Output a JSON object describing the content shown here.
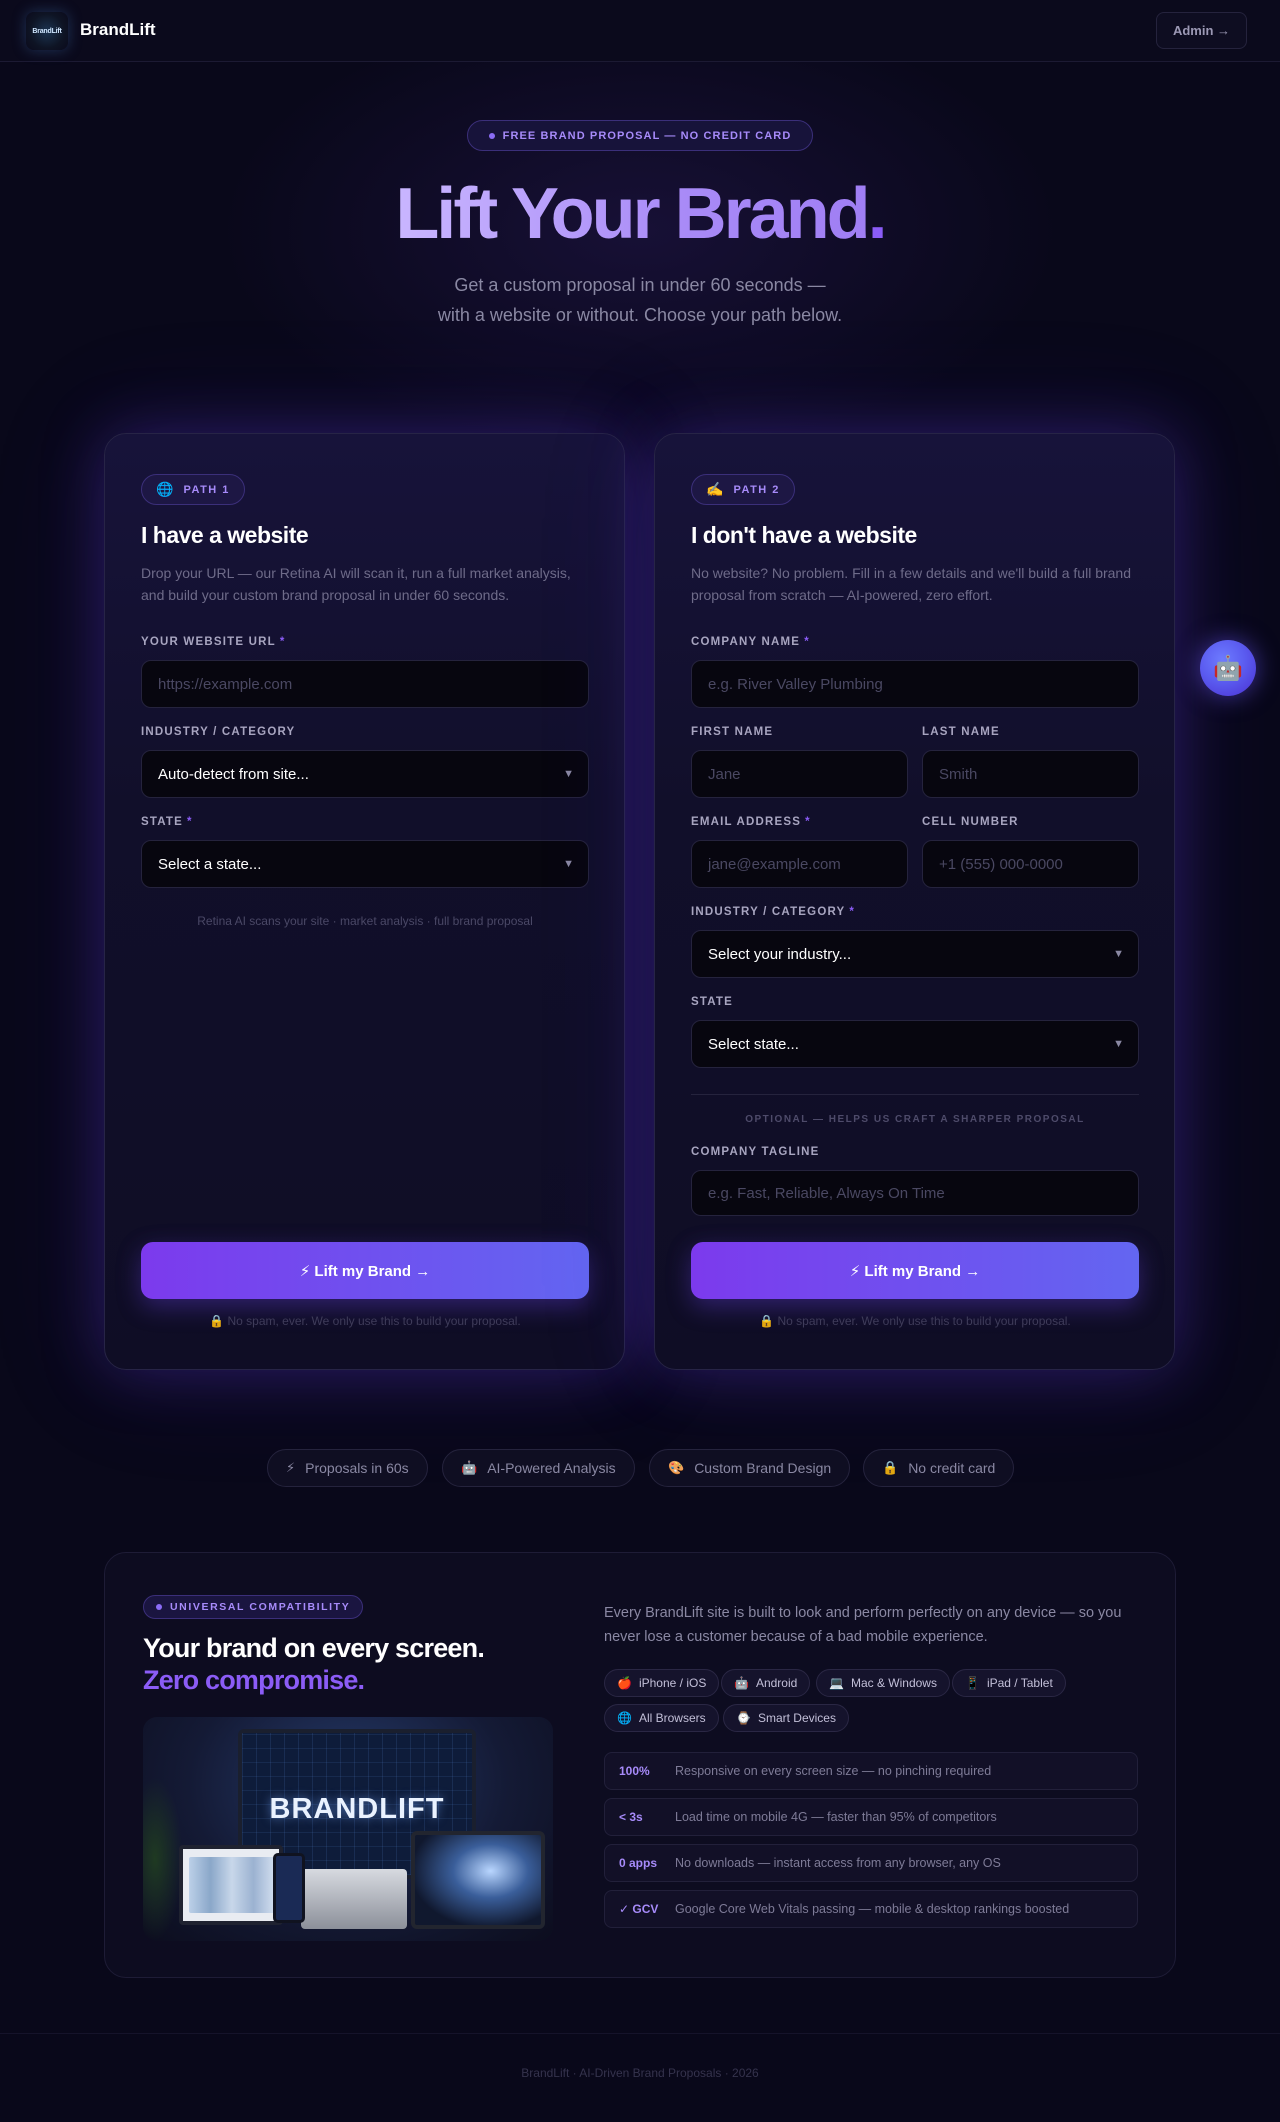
{
  "nav": {
    "logo_text": "BrandLift",
    "brand_name": "BrandLift",
    "admin_label": "Admin →"
  },
  "hero": {
    "badge": "FREE BRAND PROPOSAL — NO CREDIT CARD",
    "title_main": "Lift Your Brand",
    "title_period": ".",
    "subtitle_line1": "Get a custom proposal in under 60 seconds —",
    "subtitle_line2": "with a website or without. Choose your path below."
  },
  "path1": {
    "badge_icon": "🌐",
    "badge_label": "PATH 1",
    "title": "I have a website",
    "description": "Drop your URL — our Retina AI will scan it, run a full market analysis, and build your custom brand proposal in under 60 seconds.",
    "url_label": "YOUR WEBSITE URL",
    "url_placeholder": "https://example.com",
    "industry_label": "INDUSTRY / CATEGORY",
    "industry_value": "Auto-detect from site...",
    "state_label": "STATE",
    "state_value": "Select a state...",
    "scan_note": "Retina AI scans your site · market analysis · full brand proposal",
    "cta": "⚡ Lift my Brand →",
    "no_spam": "🔒 No spam, ever. We only use this to build your proposal."
  },
  "path2": {
    "badge_icon": "✍️",
    "badge_label": "PATH 2",
    "title": "I don't have a website",
    "description": "No website? No problem. Fill in a few details and we'll build a full brand proposal from scratch — AI-powered, zero effort.",
    "company_label": "COMPANY NAME",
    "company_placeholder": "e.g. River Valley Plumbing",
    "first_label": "FIRST NAME",
    "first_placeholder": "Jane",
    "last_label": "LAST NAME",
    "last_placeholder": "Smith",
    "email_label": "EMAIL ADDRESS",
    "email_placeholder": "jane@example.com",
    "cell_label": "CELL NUMBER",
    "cell_placeholder": "+1 (555) 000-0000",
    "industry_label": "INDUSTRY / CATEGORY",
    "industry_value": "Select your industry...",
    "state_label": "STATE",
    "state_value": "Select state...",
    "optional_label": "OPTIONAL — HELPS US CRAFT A SHARPER PROPOSAL",
    "tagline_label": "COMPANY TAGLINE",
    "tagline_placeholder": "e.g. Fast, Reliable, Always On Time",
    "cta": "⚡ Lift my Brand →",
    "no_spam": "🔒 No spam, ever. We only use this to build your proposal."
  },
  "required_mark": "*",
  "chat_icon": "🤖",
  "features": [
    {
      "icon": "⚡",
      "label": "Proposals in 60s"
    },
    {
      "icon": "🤖",
      "label": "AI-Powered Analysis"
    },
    {
      "icon": "🎨",
      "label": "Custom Brand Design"
    },
    {
      "icon": "🔒",
      "label": "No credit card"
    }
  ],
  "compat": {
    "badge": "UNIVERSAL COMPATIBILITY",
    "title_line1": "Your brand on every screen.",
    "title_line2": "Zero compromise.",
    "image_word": "BRANDLIFT",
    "description": "Every BrandLift site is built to look and perform perfectly on any device — so you never lose a customer because of a bad mobile experience.",
    "chips": [
      {
        "icon": "🍎",
        "label": "iPhone / iOS"
      },
      {
        "icon": "🤖",
        "label": "Android"
      },
      {
        "icon": "💻",
        "label": "Mac & Windows"
      },
      {
        "icon": "📱",
        "label": "iPad / Tablet"
      },
      {
        "icon": "🌐",
        "label": "All Browsers"
      },
      {
        "icon": "⌚",
        "label": "Smart Devices"
      }
    ],
    "stats": [
      {
        "value": "100%",
        "text": "Responsive on every screen size — no pinching required"
      },
      {
        "value": "< 3s",
        "text": "Load time on mobile 4G — faster than 95% of competitors"
      },
      {
        "value": "0 apps",
        "text": "No downloads — instant access from any browser, any OS"
      },
      {
        "value": "✓ GCV",
        "text": "Google Core Web Vitals passing — mobile & desktop rankings boosted"
      }
    ]
  },
  "footer": "BrandLift · AI-Driven Brand Proposals · 2026"
}
